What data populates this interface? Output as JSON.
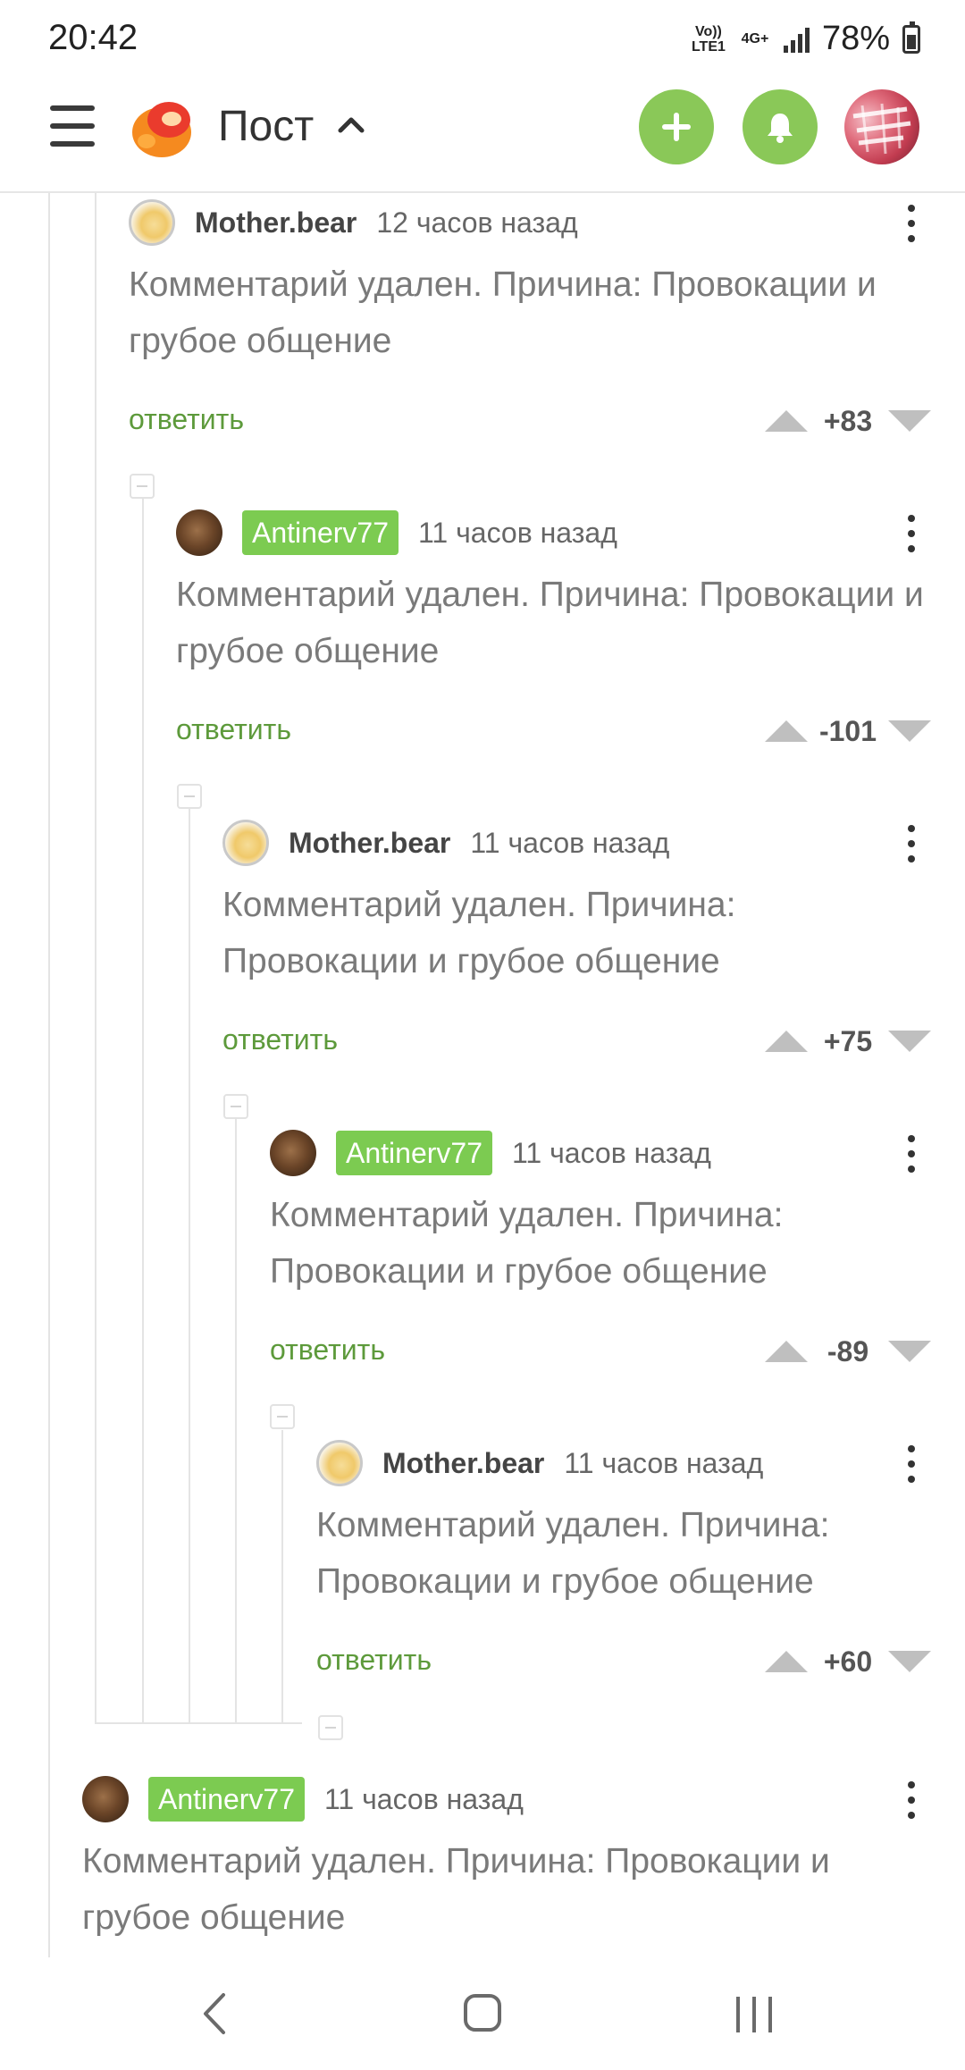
{
  "status_bar": {
    "time": "20:42",
    "net1": "Vo)) LTE1",
    "net2": "4G+",
    "battery": "78%"
  },
  "header": {
    "title": "Пост"
  },
  "icons": {
    "menu": "menu-icon",
    "logo": "pikabu-logo",
    "chevron": "chevron-up-icon",
    "add": "plus-icon",
    "bell": "bell-icon",
    "more": "more-vertical-icon",
    "upvote": "triangle-up-icon",
    "downvote": "triangle-down-icon",
    "back": "back-icon",
    "home": "home-icon",
    "recents": "recents-icon"
  },
  "colors": {
    "accent": "#8ac858",
    "badge": "#7ccb51",
    "reply": "#5d9a3b",
    "deleted_text": "#7a7a7a"
  },
  "comments": [
    {
      "user": "Mother.bear",
      "time": "12 часов назад",
      "text": "Комментарий удален. Причина: Провокации и грубое общение",
      "reply": "ответить",
      "score": "+83"
    },
    {
      "user": "Antinerv77",
      "time": "11 часов назад",
      "text": "Комментарий удален. Причина: Провокации и грубое общение",
      "reply": "ответить",
      "score": "-101"
    },
    {
      "user": "Mother.bear",
      "time": "11 часов назад",
      "text": "Комментарий удален. Причина: Провокации и грубое общение",
      "reply": "ответить",
      "score": "+75"
    },
    {
      "user": "Antinerv77",
      "time": "11 часов назад",
      "text": "Комментарий удален. Причина: Провокации и грубое общение",
      "reply": "ответить",
      "score": "-89"
    },
    {
      "user": "Mother.bear",
      "time": "11 часов назад",
      "text": "Комментарий удален. Причина: Провокации и грубое общение",
      "reply": "ответить",
      "score": "+60"
    },
    {
      "user": "Antinerv77",
      "time": "11 часов назад",
      "text": "Комментарий удален. Причина: Провокации и грубое общение"
    }
  ]
}
